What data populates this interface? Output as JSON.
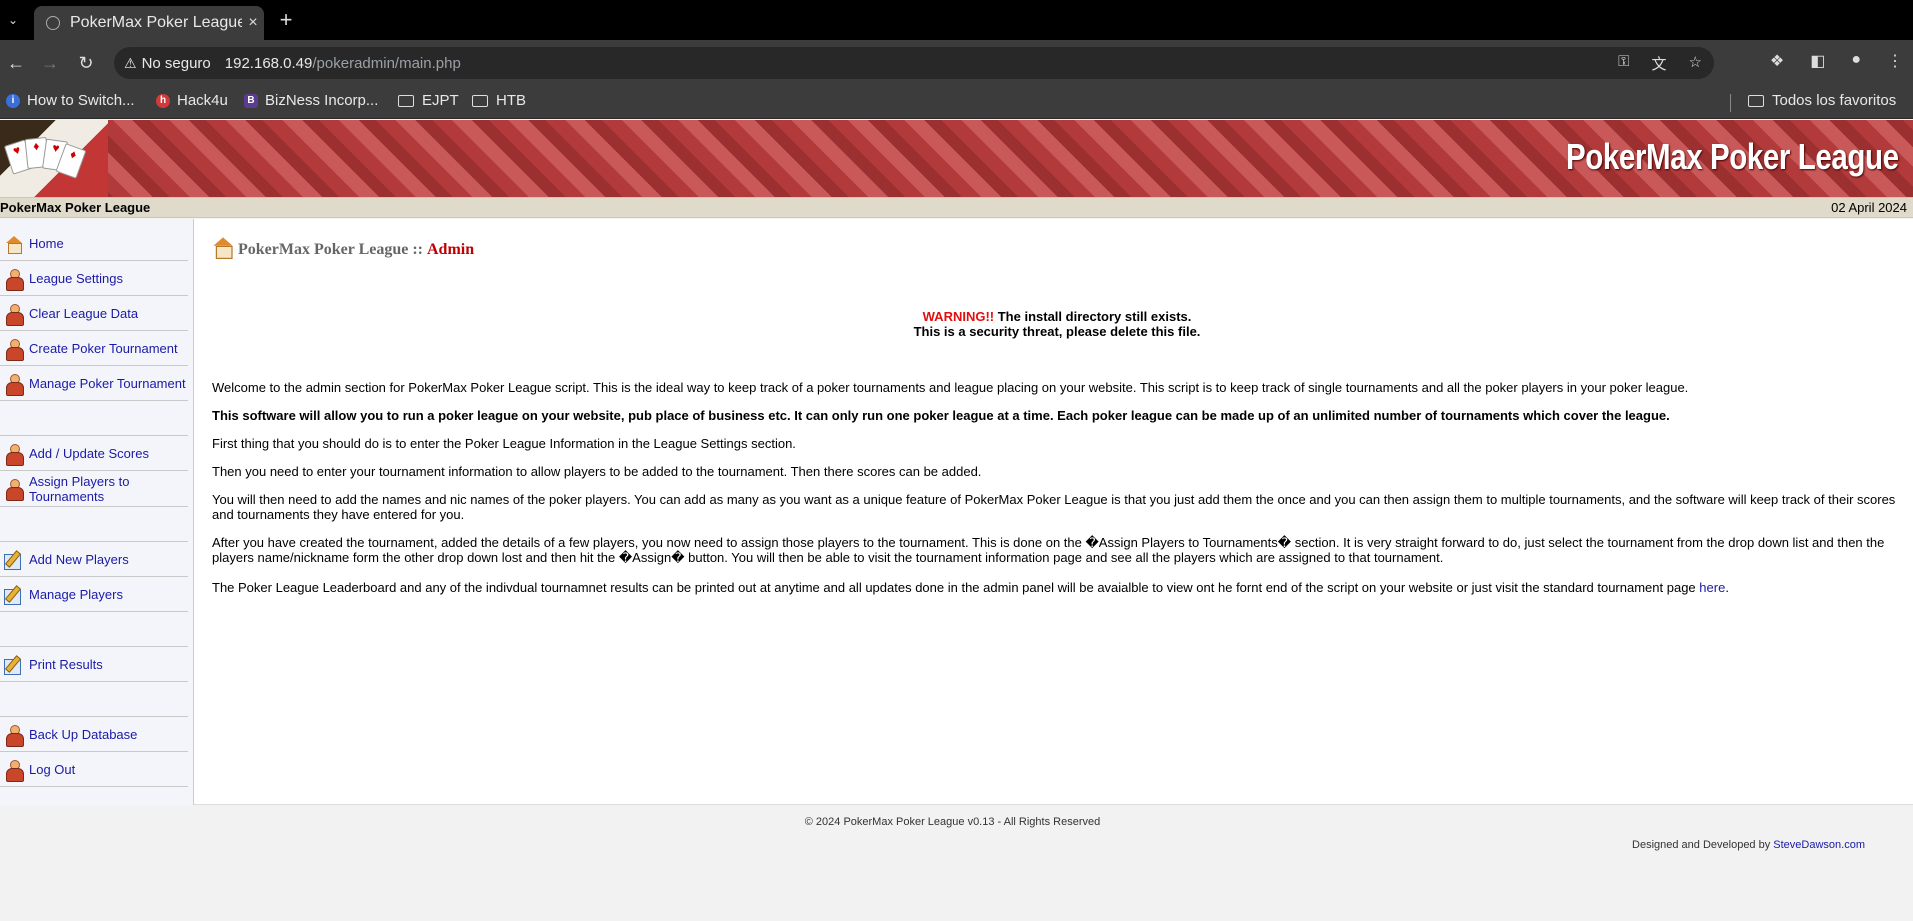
{
  "browser": {
    "tab_title": "PokerMax Poker League",
    "tab_close": "×",
    "new_tab": "+",
    "security_label": "No seguro",
    "url_host": "192.168.0.49",
    "url_path": "/pokeradmin/main.php",
    "bookmarks": [
      {
        "label": "How to Switch..."
      },
      {
        "label": "Hack4u"
      },
      {
        "label": "BizNess Incorp..."
      },
      {
        "label": "EJPT"
      },
      {
        "label": "HTB"
      }
    ],
    "all_bookmarks": "Todos los favoritos"
  },
  "site": {
    "banner_title": "PokerMax Poker League",
    "infobar_name": "PokerMax Poker League",
    "date": "02 April 2024"
  },
  "sidebar": {
    "items": [
      {
        "label": "Home",
        "icon": "home-icon"
      },
      {
        "label": "League Settings",
        "icon": "user-icon"
      },
      {
        "label": "Clear League Data",
        "icon": "user-icon"
      },
      {
        "label": "Create Poker Tournament",
        "icon": "user-icon"
      },
      {
        "label": "Manage Poker Tournament",
        "icon": "user-icon"
      },
      {
        "label": "Add / Update Scores",
        "icon": "user-icon"
      },
      {
        "label": "Assign Players to Tournaments",
        "icon": "user-icon"
      },
      {
        "label": "Add New Players",
        "icon": "edit-icon"
      },
      {
        "label": "Manage Players",
        "icon": "edit-icon"
      },
      {
        "label": "Print Results",
        "icon": "edit-icon"
      },
      {
        "label": "Back Up Database",
        "icon": "user-icon"
      },
      {
        "label": "Log Out",
        "icon": "user-icon"
      }
    ]
  },
  "main": {
    "heading_site": "PokerMax Poker League ::",
    "heading_section": "Admin",
    "warning_label": "WARNING!!",
    "warning_line1": " The install directory still exists.",
    "warning_line2": "This is a security threat, please delete this file.",
    "para1": "Welcome to the admin section for PokerMax Poker League script. This is the ideal way to keep track of a poker tournaments and league placing on your website. This script is to keep track of single tournaments and all the poker players in your poker league.",
    "para2": "This software will allow you to run a poker league on your website, pub place of business etc. It can only run one poker league at a time. Each poker league can be made up of an unlimited number of tournaments which cover the league.",
    "para3": "First thing that you should do is to enter the Poker League Information in the League Settings section.",
    "para4": "Then you need to enter your tournament information to allow players to be added to the tournament. Then there scores can be added.",
    "para5": "You will then need to add the names and nic names of the poker players. You can add as many as you want as a unique feature of PokerMax Poker League is that you just add them the once and you can then assign them to multiple tournaments, and the software will keep track of their scores and tournaments they have entered for you.",
    "para6": "After you have created the tournament, added the details of a few players, you now need to assign those players to the tournament. This is done on the �Assign Players to Tournaments� section. It is very straight forward to do, just select the tournament from the drop down list and then the players name/nickname form the other drop down lost and then hit the �Assign� button. You will then be able to visit the tournament information page and see all the players which are assigned to that tournament.",
    "para7": "The Poker League Leaderboard and any of the indivdual tournamnet results can be printed out at anytime and all updates done in the admin panel will be avaialble to view ont he fornt end of the script on your website or just visit the standard tournament page ",
    "para7_link": "here",
    "para7_end": "."
  },
  "footer": {
    "copyright": "© 2024 PokerMax Poker League v0.13 - All Rights Reserved",
    "designed_by": "Designed and Developed by ",
    "designer_link": "SteveDawson.com"
  }
}
